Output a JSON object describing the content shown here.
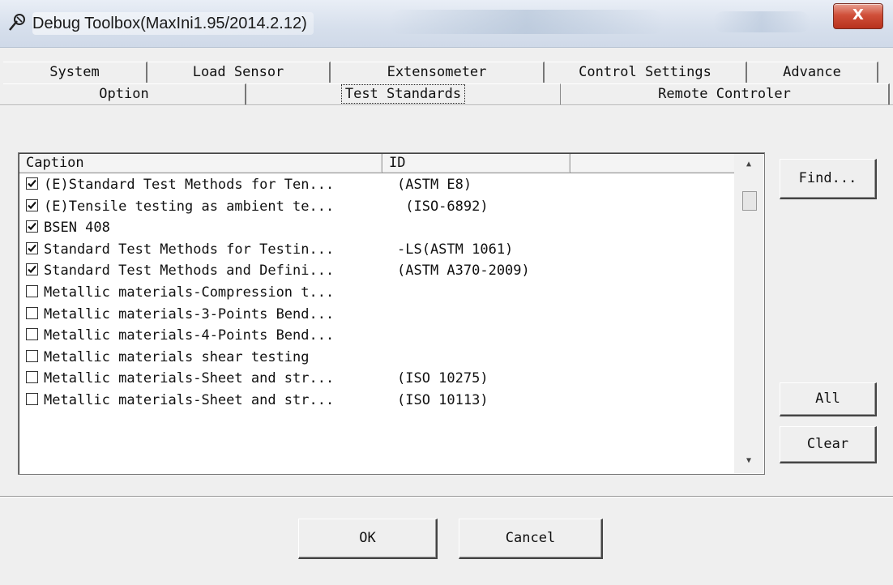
{
  "window": {
    "title": "Debug Toolbox(MaxIni1.95/2014.2.12)",
    "close_label": "X"
  },
  "tabs": {
    "row1": [
      "System",
      "Load Sensor",
      "Extensometer",
      "Control Settings",
      "Advance"
    ],
    "row2": [
      "Option",
      "Test Standards",
      "Remote Controler"
    ],
    "active": "Test Standards"
  },
  "list": {
    "columns": [
      "Caption",
      "ID",
      ""
    ],
    "rows": [
      {
        "caption": "(E)Standard Test Methods for Ten...",
        "id": "(ASTM E8)",
        "checked": true
      },
      {
        "caption": "(E)Tensile testing as ambient te...",
        "id": " (ISO-6892)",
        "checked": true
      },
      {
        "caption": "BSEN 408",
        "id": "",
        "checked": true
      },
      {
        "caption": "Standard Test Methods for Testin...",
        "id": "-LS(ASTM 1061)",
        "checked": true
      },
      {
        "caption": "Standard Test Methods and Defini...",
        "id": "(ASTM A370-2009)",
        "checked": true
      },
      {
        "caption": "Metallic materials-Compression t...",
        "id": "",
        "checked": false
      },
      {
        "caption": "Metallic materials-3-Points Bend...",
        "id": "",
        "checked": false
      },
      {
        "caption": "Metallic materials-4-Points Bend...",
        "id": "",
        "checked": false
      },
      {
        "caption": "Metallic materials shear testing",
        "id": "",
        "checked": false
      },
      {
        "caption": "Metallic materials-Sheet and str...",
        "id": "(ISO 10275)",
        "checked": false
      },
      {
        "caption": "Metallic materials-Sheet and str...",
        "id": "(ISO 10113)",
        "checked": false
      }
    ]
  },
  "buttons": {
    "find": "Find...",
    "all": "All",
    "clear": "Clear",
    "ok": "OK",
    "cancel": "Cancel"
  }
}
